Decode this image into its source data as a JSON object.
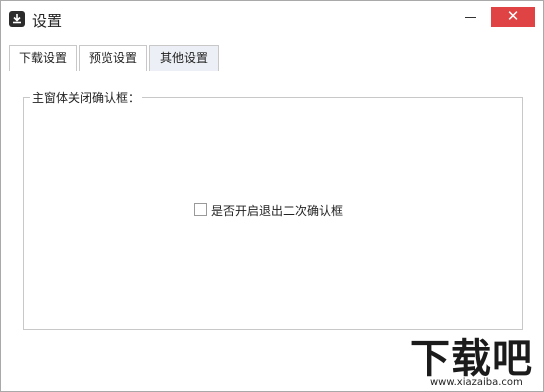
{
  "window": {
    "title": "设置",
    "close_glyph": "✕"
  },
  "tabs": [
    {
      "label": "下载设置"
    },
    {
      "label": "预览设置"
    },
    {
      "label": "其他设置"
    }
  ],
  "active_tab": 2,
  "group": {
    "legend": "主窗体关闭确认框："
  },
  "option": {
    "label": "是否开启退出二次确认框",
    "checked": false
  },
  "watermark": {
    "text": "下载吧",
    "url": "www.xiazaiba.com"
  },
  "colors": {
    "close_bg": "#e04343",
    "active_tab_bg": "#eceff5"
  }
}
